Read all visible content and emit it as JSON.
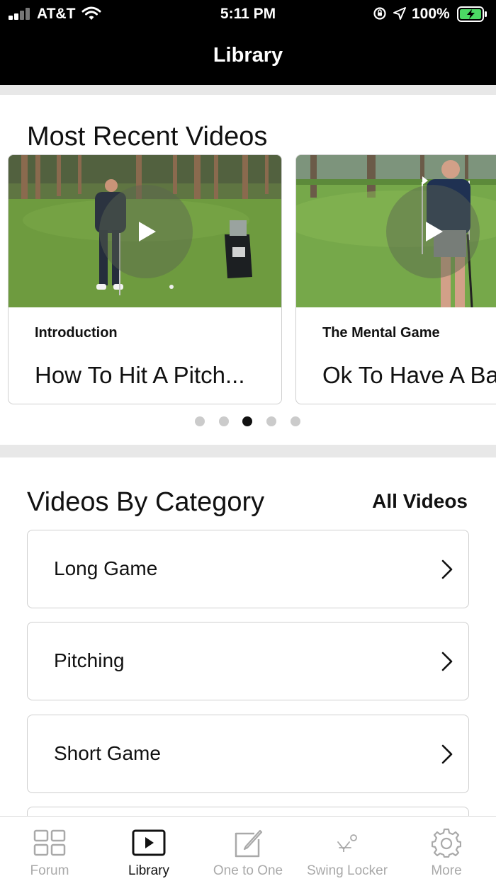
{
  "status_bar": {
    "carrier": "AT&T",
    "time": "5:11 PM",
    "battery": "100%"
  },
  "nav": {
    "title": "Library"
  },
  "recent": {
    "heading": "Most Recent Videos",
    "cards": [
      {
        "category": "Introduction",
        "title": "How To Hit A Pitch..."
      },
      {
        "category": "The Mental Game",
        "title": "Ok To Have A Ba"
      }
    ],
    "page_count": 5,
    "active_page": 3
  },
  "categories": {
    "heading": "Videos By Category",
    "all_label": "All Videos",
    "items": [
      "Long Game",
      "Pitching",
      "Short Game",
      ""
    ]
  },
  "tabs": [
    {
      "label": "Forum",
      "icon": "grid-icon"
    },
    {
      "label": "Library",
      "icon": "play-box-icon"
    },
    {
      "label": "One to One",
      "icon": "edit-icon"
    },
    {
      "label": "Swing Locker",
      "icon": "golf-tee-icon"
    },
    {
      "label": "More",
      "icon": "gear-icon"
    }
  ],
  "active_tab": "Library"
}
